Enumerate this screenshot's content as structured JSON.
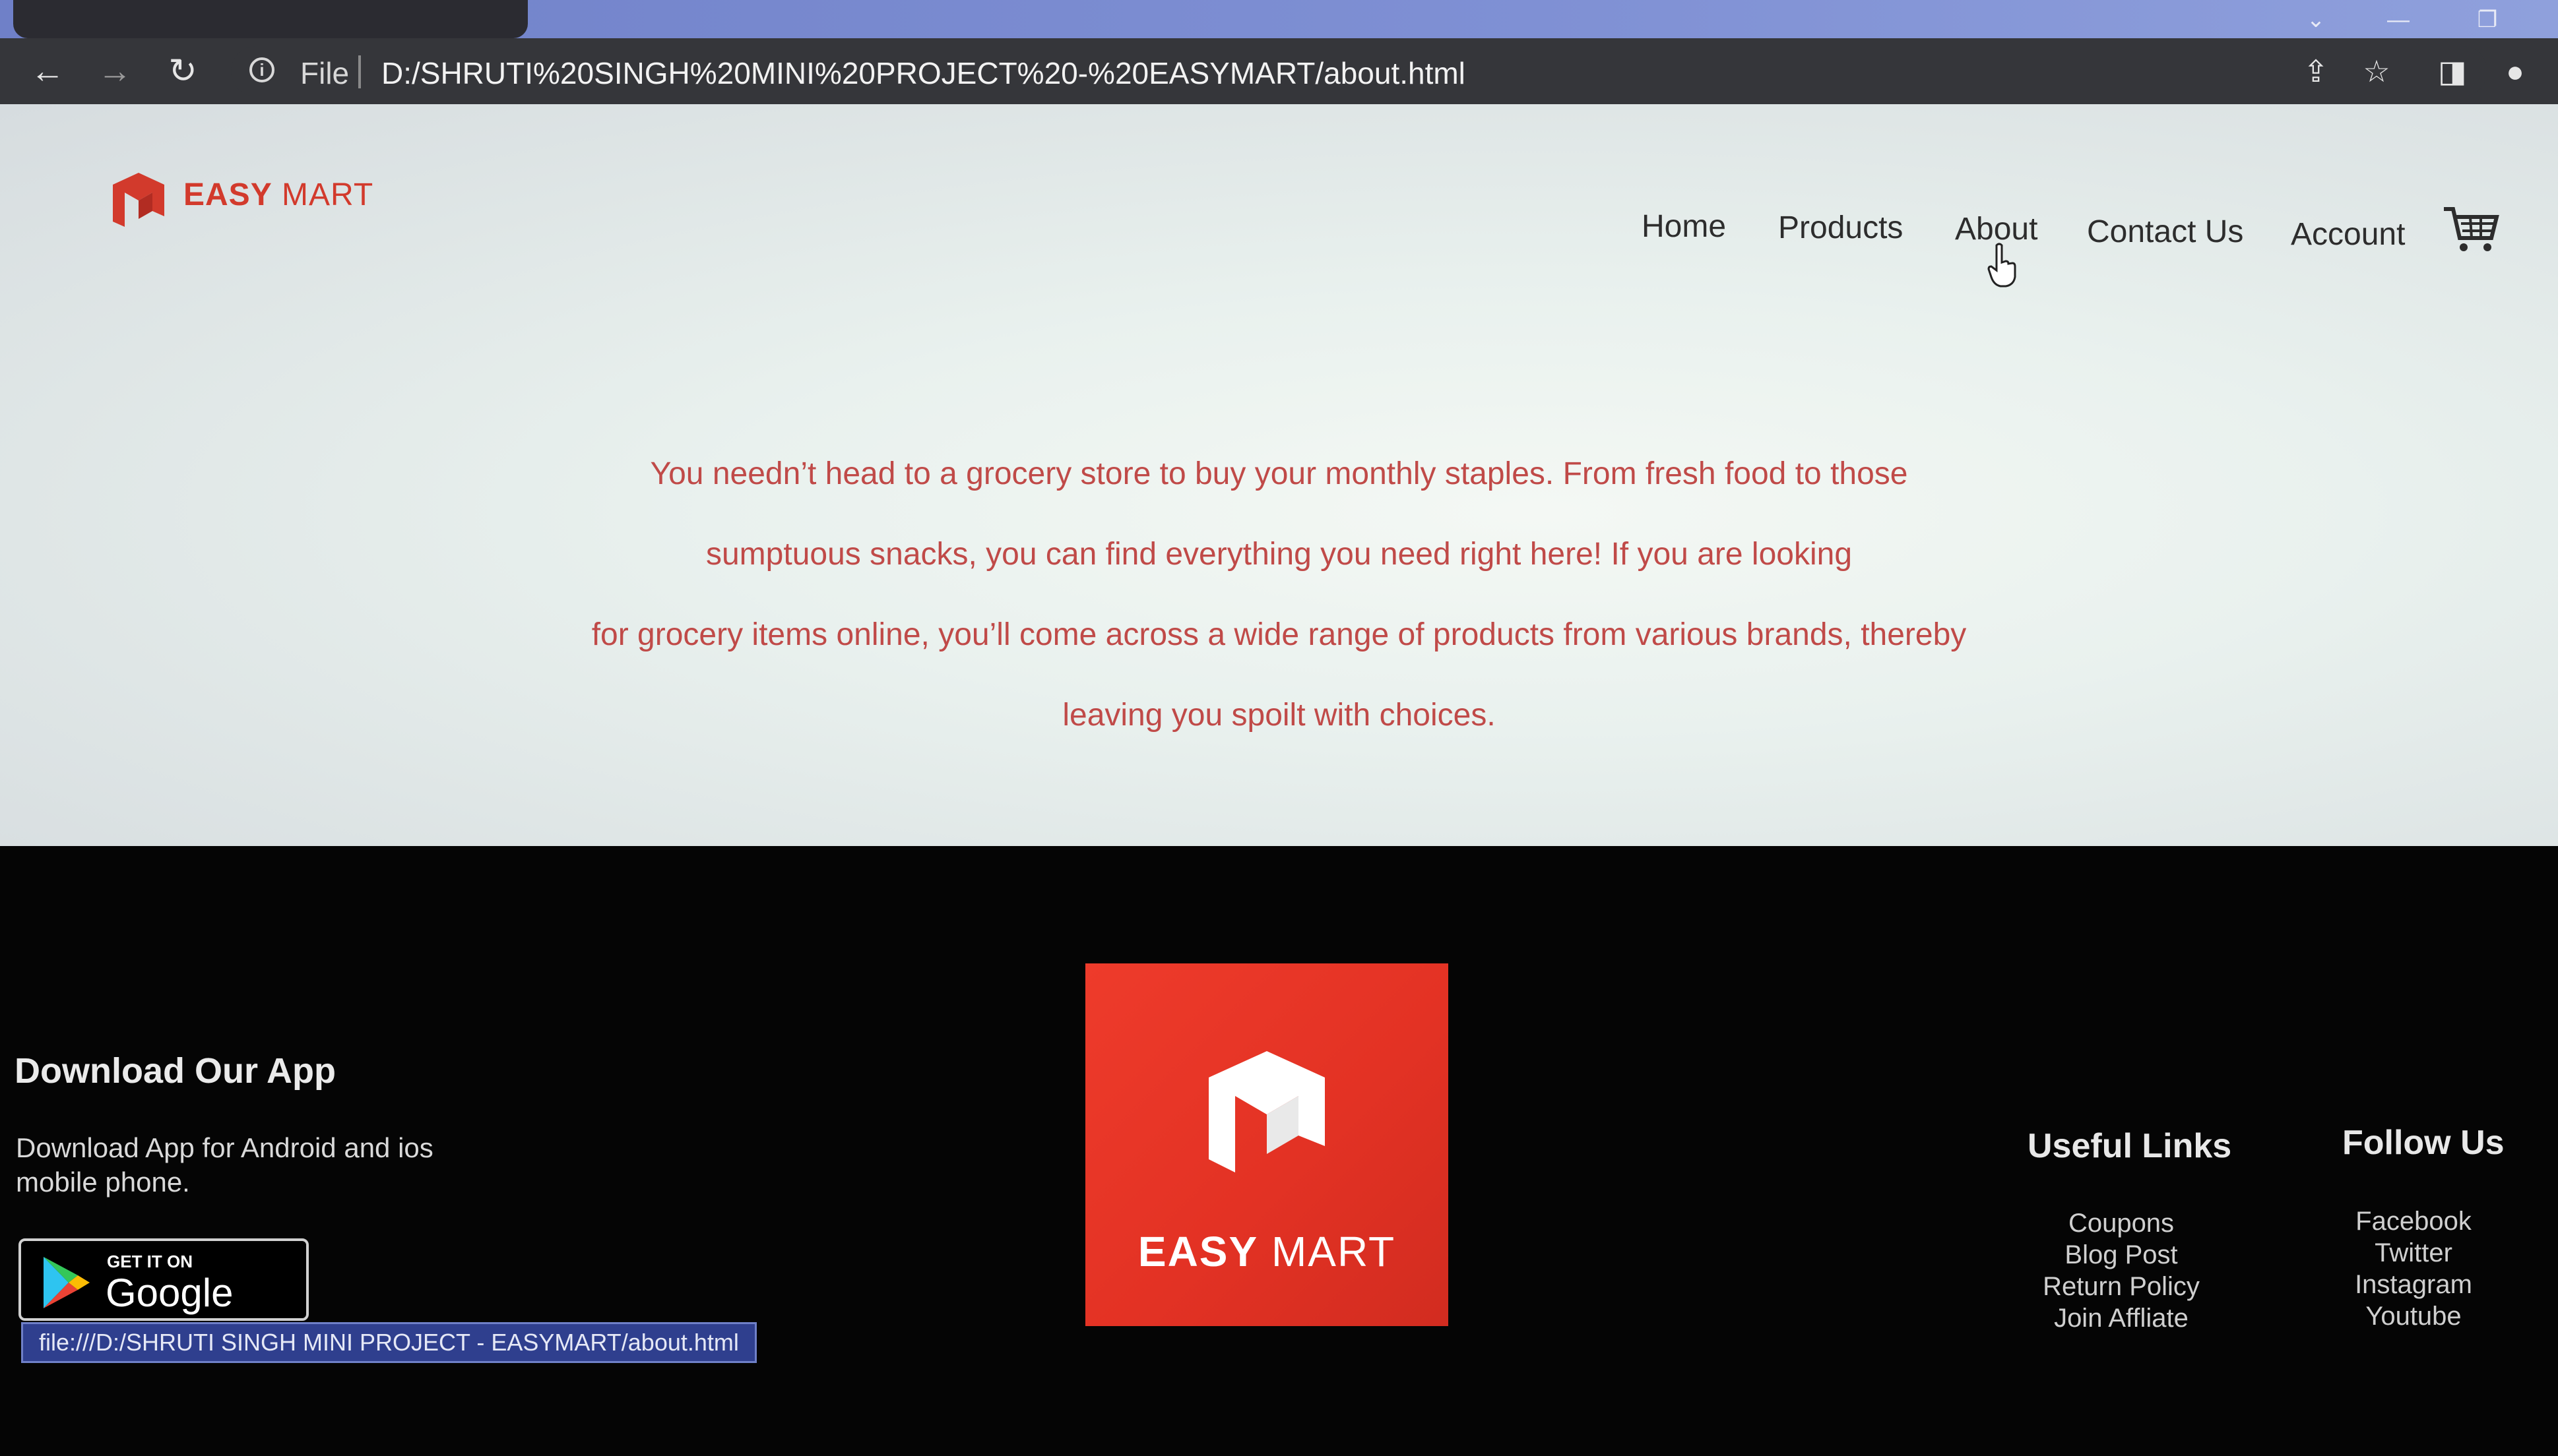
{
  "browser": {
    "omnibox_scheme": "File",
    "url": "D:/SHRUTI%20SINGH%20MINI%20PROJECT%20-%20EASYMART/about.html",
    "status_url": "file:///D:/SHRUTI SINGH MINI PROJECT - EASYMART/about.html"
  },
  "brand": {
    "name_bold": "EASY",
    "name_light": " MART",
    "color": "#d23a2c"
  },
  "nav": {
    "items": [
      {
        "label": "Home"
      },
      {
        "label": "Products"
      },
      {
        "label": "About"
      },
      {
        "label": "Contact Us"
      },
      {
        "label": "Account"
      }
    ]
  },
  "hero": {
    "lines": [
      "You needn’t head to a grocery store to buy your monthly staples. From fresh food to those",
      "sumptuous snacks, you can find everything you need right here! If you are looking",
      "for grocery items online, you’ll come across a wide range of products from various brands, thereby",
      "leaving you spoilt with choices."
    ],
    "text_color": "#c04a48"
  },
  "footer": {
    "app_title": "Download Our App",
    "app_desc_line1": "Download App for Android and ios",
    "app_desc_line2": "mobile phone.",
    "gplay_small": "GET IT ON",
    "gplay_big": "Google Play",
    "big_logo_bold": "EASY",
    "big_logo_light": " MART",
    "useful_links": {
      "title": "Useful Links",
      "items": [
        "Coupons",
        "Blog Post",
        "Return Policy",
        "Join Affliate"
      ]
    },
    "follow_us": {
      "title": "Follow Us",
      "items": [
        "Facebook",
        "Twitter",
        "Instagram",
        "Youtube"
      ]
    }
  }
}
